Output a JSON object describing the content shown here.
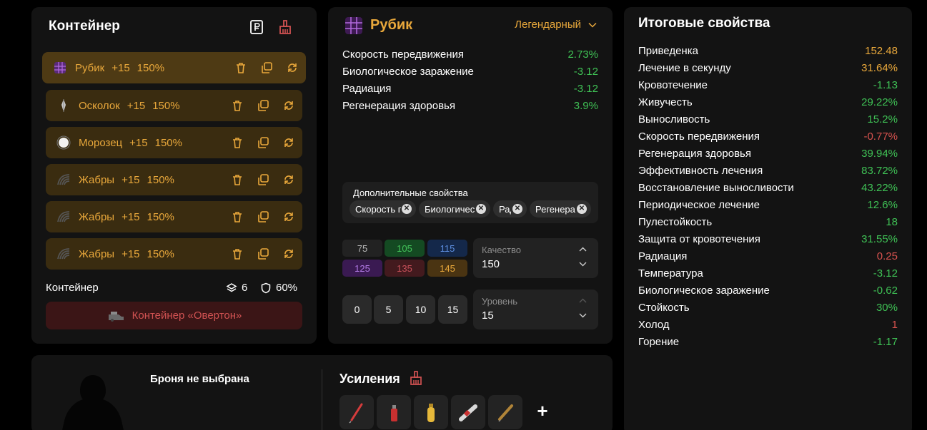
{
  "container": {
    "title": "Контейнер",
    "slots": [
      {
        "name": "Рубик",
        "level": "+15",
        "percent": "150%",
        "icon": "rubik-artifact-icon"
      },
      {
        "name": "Осколок",
        "level": "+15",
        "percent": "150%",
        "icon": "shard-artifact-icon"
      },
      {
        "name": "Морозец",
        "level": "+15",
        "percent": "150%",
        "icon": "frost-artifact-icon"
      },
      {
        "name": "Жабры",
        "level": "+15",
        "percent": "150%",
        "icon": "gills-artifact-icon"
      },
      {
        "name": "Жабры",
        "level": "+15",
        "percent": "150%",
        "icon": "gills-artifact-icon"
      },
      {
        "name": "Жабры",
        "level": "+15",
        "percent": "150%",
        "icon": "gills-artifact-icon"
      }
    ],
    "footer_label": "Контейнер",
    "capacity": "6",
    "protection": "60%",
    "container_button": "Контейнер «Овертон»"
  },
  "artifact": {
    "name": "Рубик",
    "rarity": "Легендарный",
    "properties": [
      {
        "name": "Скорость передвижения",
        "value": "2.73%"
      },
      {
        "name": "Биологическое заражение",
        "value": "-3.12"
      },
      {
        "name": "Радиация",
        "value": "-3.12"
      },
      {
        "name": "Регенерация здоровья",
        "value": "3.9%"
      }
    ],
    "extra_title": "Дополнительные свойства",
    "extra_chips": [
      "Скорость передвижения",
      "Биологическое заражение",
      "Радиация",
      "Регенерация здоровья"
    ],
    "quality_presets": [
      {
        "label": "75",
        "color": "#222222",
        "text": "#b8b8b8"
      },
      {
        "label": "105",
        "color": "#144a22",
        "text": "#44c35a"
      },
      {
        "label": "115",
        "color": "#14284a",
        "text": "#5e8fe0"
      },
      {
        "label": "125",
        "color": "#3a1a52",
        "text": "#b37be6"
      },
      {
        "label": "135",
        "color": "#431a1e",
        "text": "#c65059"
      },
      {
        "label": "145",
        "color": "#4a3412",
        "text": "#e9a83b"
      }
    ],
    "quality_label": "Качество",
    "quality_value": "150",
    "level_presets": [
      "0",
      "5",
      "10",
      "15"
    ],
    "level_label": "Уровень",
    "level_value": "15"
  },
  "totals": {
    "title": "Итоговые свойства",
    "rows": [
      {
        "name": "Приведенка",
        "value": "152.48",
        "color": "#e9a83b"
      },
      {
        "name": "Лечение в секунду",
        "value": "31.64%",
        "color": "#e9a83b"
      },
      {
        "name": "Кровотечение",
        "value": "-1.13",
        "color": "#3fc155"
      },
      {
        "name": "Живучесть",
        "value": "29.22%",
        "color": "#3fc155"
      },
      {
        "name": "Выносливость",
        "value": "15.2%",
        "color": "#3fc155"
      },
      {
        "name": "Скорость передвижения",
        "value": "-0.77%",
        "color": "#d9534f"
      },
      {
        "name": "Регенерация здоровья",
        "value": "39.94%",
        "color": "#3fc155"
      },
      {
        "name": "Эффективность лечения",
        "value": "83.72%",
        "color": "#3fc155"
      },
      {
        "name": "Восстановление выносливости",
        "value": "43.22%",
        "color": "#3fc155"
      },
      {
        "name": "Периодическое лечение",
        "value": "12.6%",
        "color": "#3fc155"
      },
      {
        "name": "Пулестойкость",
        "value": "18",
        "color": "#3fc155"
      },
      {
        "name": "Защита от кровотечения",
        "value": "31.55%",
        "color": "#3fc155"
      },
      {
        "name": "Радиация",
        "value": "0.25",
        "color": "#d9534f"
      },
      {
        "name": "Температура",
        "value": "-3.12",
        "color": "#3fc155"
      },
      {
        "name": "Биологическое заражение",
        "value": "-0.62",
        "color": "#3fc155"
      },
      {
        "name": "Стойкость",
        "value": "30%",
        "color": "#3fc155"
      },
      {
        "name": "Холод",
        "value": "1",
        "color": "#d9534f"
      },
      {
        "name": "Горение",
        "value": "-1.17",
        "color": "#3fc155"
      }
    ]
  },
  "armor": {
    "label": "Броня не выбрана",
    "boosts_label": "Усиления",
    "boost_items": [
      "syringe-red-icon",
      "spray-can-icon",
      "yellow-bottle-icon",
      "injector-icon",
      "vial-icon"
    ],
    "add_label": "+"
  }
}
